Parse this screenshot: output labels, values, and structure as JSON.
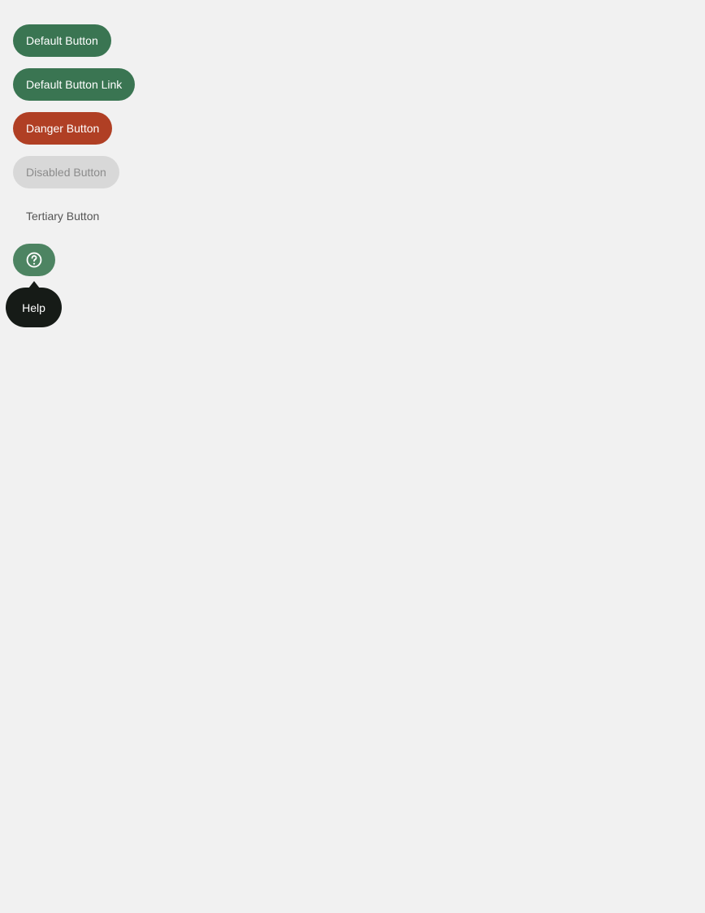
{
  "buttons": {
    "default_label": "Default Button",
    "default_link_label": "Default Button Link",
    "danger_label": "Danger Button",
    "disabled_label": "Disabled Button",
    "tertiary_label": "Tertiary Button",
    "help_icon": "help-circle-icon"
  },
  "tooltip": {
    "text": "Help"
  },
  "colors": {
    "page_background": "#f1f1f1",
    "primary": "#3a7552",
    "danger": "#b03f24",
    "disabled_background": "#d8d8d8",
    "disabled_text": "#8c8c8c",
    "tertiary_text": "#555555",
    "icon_button": "#4d8462",
    "tooltip_background": "#161b17"
  }
}
